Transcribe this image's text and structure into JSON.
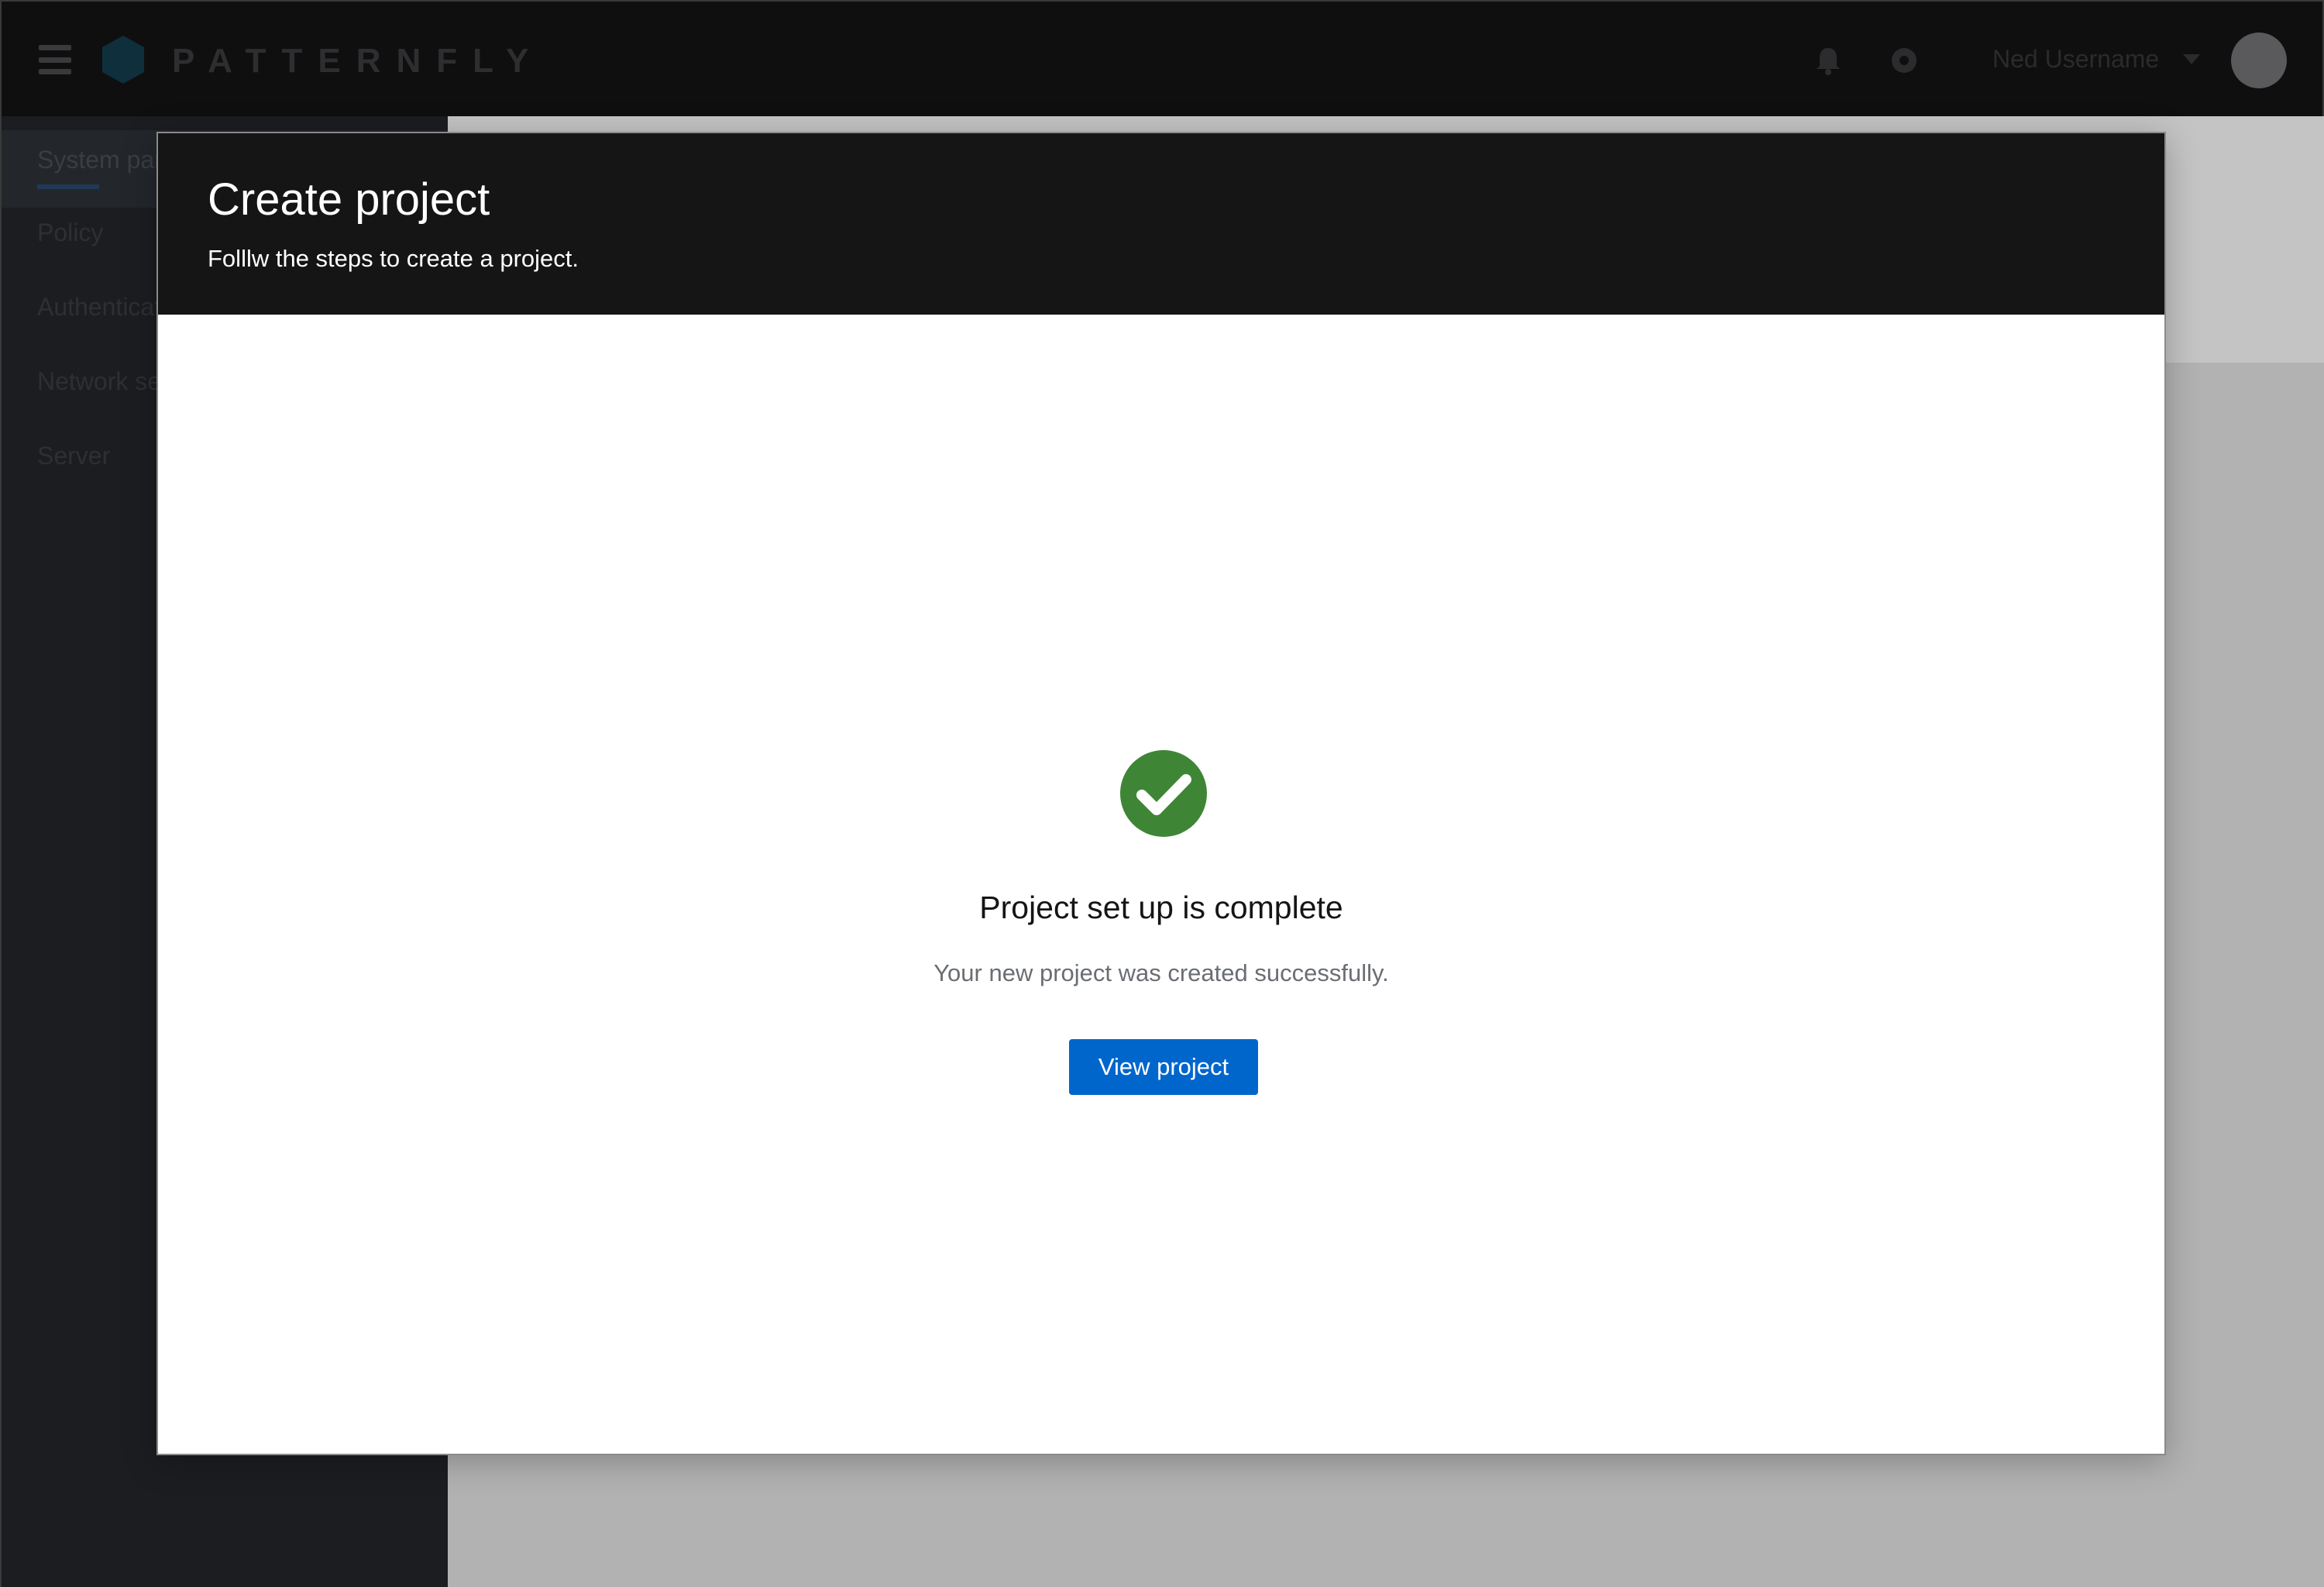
{
  "background_app": {
    "brand": "PATTERNFLY",
    "user_name": "Ned Username",
    "nav_items": [
      "System panel",
      "Policy",
      "Authentication",
      "Network services",
      "Server"
    ]
  },
  "modal": {
    "title": "Create project",
    "description": "Folllw the steps to create a project."
  },
  "finish": {
    "icon": "check-circle-icon",
    "title": "Project set up is complete",
    "body": "Your new project was created successfully.",
    "primary_button": "View project"
  },
  "colors": {
    "modal_header": "#151515",
    "success": "#3e8635",
    "primary": "#0066cc",
    "backdrop": "#b2b2b2"
  }
}
